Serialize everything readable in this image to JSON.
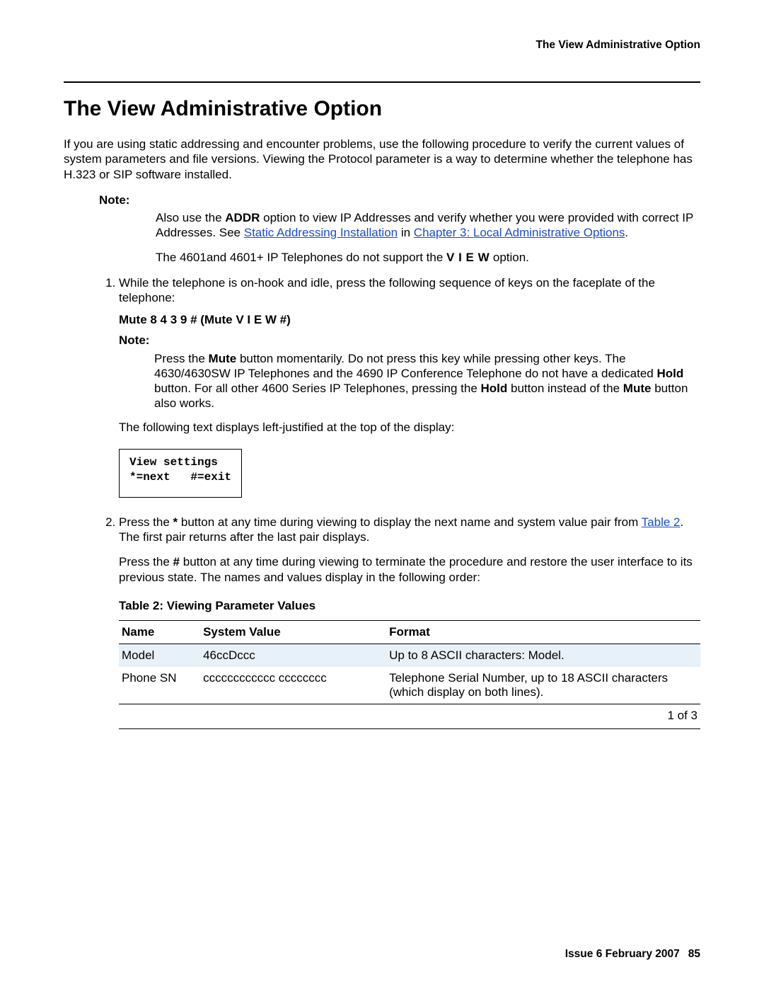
{
  "running_head": "The View Administrative Option",
  "title": "The View Administrative Option",
  "intro": "If you are using static addressing and encounter problems, use the following procedure to verify the current values of system parameters and file versions. Viewing the Protocol parameter is a way to determine whether the telephone has H.323 or SIP software installed.",
  "note1": {
    "label": "Note:",
    "pre": "Also use the ",
    "addr": "ADDR",
    "mid": " option to view IP Addresses and verify whether you were provided with correct IP Addresses. See ",
    "link1": "Static Addressing Installation",
    "between": " in ",
    "link2": "Chapter 3: Local Administrative Options",
    "end": ".",
    "para2_pre": "The 4601and 4601+ IP Telephones do not support the ",
    "para2_bold": "V I E W",
    "para2_post": " option."
  },
  "step1": {
    "text": "While the telephone is on-hook and idle, press the following sequence of keys on the faceplate of the telephone:",
    "mute_seq": "Mute 8 4 3 9 # (Mute V I E W #)",
    "note_label": "Note:",
    "note_pre": "Press the ",
    "note_mute": "Mute",
    "note_mid1": " button momentarily. Do not press this key while pressing other keys. The 4630/4630SW IP Telephones and the 4690 IP Conference Telephone do not have a dedicated ",
    "note_hold": "Hold",
    "note_mid2": " button. For all other 4600 Series IP Telephones, pressing the ",
    "note_hold2": "Hold",
    "note_mid3": " button instead of the ",
    "note_mute2": "Mute",
    "note_end": " button also works.",
    "afterbox": "The following text displays left-justified at the top of the display:",
    "box_line1": "View settings",
    "box_line2": "*=next   #=exit"
  },
  "step2": {
    "pre": "Press the ",
    "star": "*",
    "mid1": " button at any time during viewing to display the next name and system value pair from ",
    "link": "Table 2",
    "mid2": ". The first pair returns after the last pair displays.",
    "para2_pre": "Press the ",
    "hash": "#",
    "para2_post": " button at any time during viewing to terminate the procedure and restore the user interface to its previous state. The names and values display in the following order:"
  },
  "table": {
    "caption": "Table 2: Viewing Parameter Values",
    "headers": {
      "c1": "Name",
      "c2": "System Value",
      "c3": "Format"
    },
    "rows": [
      {
        "name": "Model",
        "sys": "46ccDccc",
        "fmt": "Up to 8 ASCII characters: Model."
      },
      {
        "name": "Phone SN",
        "sys": "cccccccccccc cccccccc",
        "fmt": "Telephone Serial Number, up to 18 ASCII characters (which display on both lines)."
      }
    ],
    "footer": "1 of 3"
  },
  "footer": {
    "issue": "Issue 6   February 2007",
    "page": "85"
  }
}
